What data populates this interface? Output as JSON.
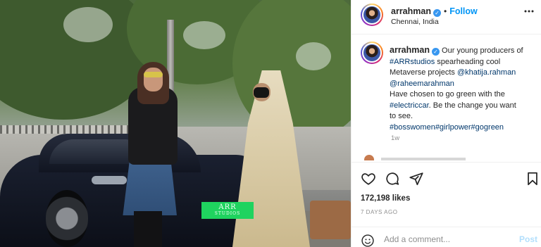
{
  "post": {
    "username": "arrahman",
    "follow_label": "Follow",
    "separator": "•",
    "location": "Chennai, India",
    "plate_line1": "ARR",
    "plate_line2": "STUDIOS"
  },
  "caption": {
    "username": "arrahman",
    "lines": [
      "Our young producers of",
      "#ARRstudios",
      " spearheading cool",
      "Metaverse projects ",
      "@khatija.rahman",
      "@raheemarahman",
      "Have chosen to go green with the",
      "#electriccar",
      ". Be the change you want",
      "to see.",
      "#bosswomen#girlpower#gogreen"
    ],
    "time": "1w"
  },
  "actions": {
    "like_icon": "heart-icon",
    "comment_icon": "comment-icon",
    "share_icon": "share-icon",
    "save_icon": "bookmark-icon"
  },
  "stats": {
    "likes": "172,198 likes",
    "time": "7 DAYS AGO"
  },
  "comment": {
    "placeholder": "Add a comment...",
    "post_label": "Post"
  },
  "colors": {
    "link": "#00376b",
    "accent": "#0095f6",
    "post_disabled": "#b2dffc",
    "muted": "#8e8e8e"
  }
}
